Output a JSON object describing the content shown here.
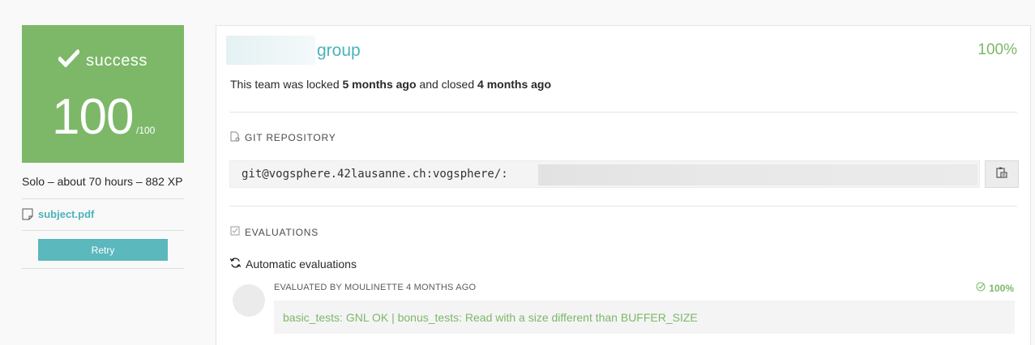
{
  "project": {
    "status_label": "success",
    "score": "100",
    "score_max": "/100",
    "meta": "Solo – about 70 hours – 882 XP",
    "subject_link": "subject.pdf",
    "retry_label": "Retry"
  },
  "team": {
    "name_suffix": "group",
    "percentage": "100%",
    "lock_prefix": "This team was locked ",
    "locked_ago": "5 months ago",
    "lock_middle": " and closed ",
    "closed_ago": "4 months ago"
  },
  "git": {
    "section_title": "GIT REPOSITORY",
    "url_visible": "git@vogsphere.42lausanne.ch:vogsphere/:"
  },
  "evaluations": {
    "section_title": "EVALUATIONS",
    "automatic_label": "Automatic evaluations",
    "evaluated_by": "EVALUATED BY MOULINETTE 4 MONTHS AGO",
    "percentage": "100%",
    "output": "basic_tests: GNL OK | bonus_tests: Read with a size different than BUFFER_SIZE"
  },
  "colors": {
    "success": "#7cb868",
    "accent": "#4bb3ba",
    "retry": "#5bb8bd"
  },
  "icons": [
    "checkmark-icon",
    "document-icon",
    "git-file-icon",
    "clipboard-icon",
    "evaluations-check-icon",
    "refresh-icon",
    "check-circle-icon"
  ]
}
